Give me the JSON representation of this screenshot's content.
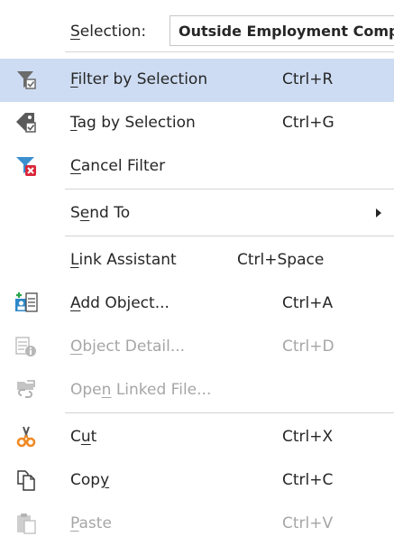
{
  "selection": {
    "label_pre": "",
    "label_u": "S",
    "label_post": "election:",
    "value": "Outside Employment Compensation"
  },
  "items": [
    {
      "pre": "",
      "u": "F",
      "post": "ilter by Selection",
      "shortcut": "Ctrl+R",
      "icon": "filter-by-selection-icon",
      "highlighted": true
    },
    {
      "pre": "",
      "u": "T",
      "post": "ag by Selection",
      "shortcut": "Ctrl+G",
      "icon": "tag-by-selection-icon"
    },
    {
      "pre": "",
      "u": "C",
      "post": "ancel Filter",
      "shortcut": "",
      "icon": "cancel-filter-icon"
    },
    {
      "pre": "S",
      "u": "e",
      "post": "nd To",
      "shortcut": "",
      "icon": "",
      "submenu": true
    },
    {
      "pre": "",
      "u": "L",
      "post": "ink Assistant",
      "shortcut": "Ctrl+Space",
      "icon": ""
    },
    {
      "pre": "",
      "u": "A",
      "post": "dd Object...",
      "shortcut": "Ctrl+A",
      "icon": "add-object-icon"
    },
    {
      "pre": "",
      "u": "O",
      "post": "bject Detail...",
      "shortcut": "Ctrl+D",
      "icon": "object-detail-icon",
      "disabled": true
    },
    {
      "pre": "Ope",
      "u": "n",
      "post": " Linked File...",
      "shortcut": "",
      "icon": "open-linked-file-icon",
      "disabled": true
    },
    {
      "pre": "C",
      "u": "u",
      "post": "t",
      "shortcut": "Ctrl+X",
      "icon": "cut-icon"
    },
    {
      "pre": "Cop",
      "u": "y",
      "post": "",
      "shortcut": "Ctrl+C",
      "icon": "copy-icon"
    },
    {
      "pre": "",
      "u": "P",
      "post": "aste",
      "shortcut": "Ctrl+V",
      "icon": "paste-icon",
      "disabled": true
    }
  ],
  "colors": {
    "highlight": "#cddcf2",
    "text": "#262626",
    "disabled_text": "#a6a6a6",
    "separator": "#d4d4d4"
  }
}
